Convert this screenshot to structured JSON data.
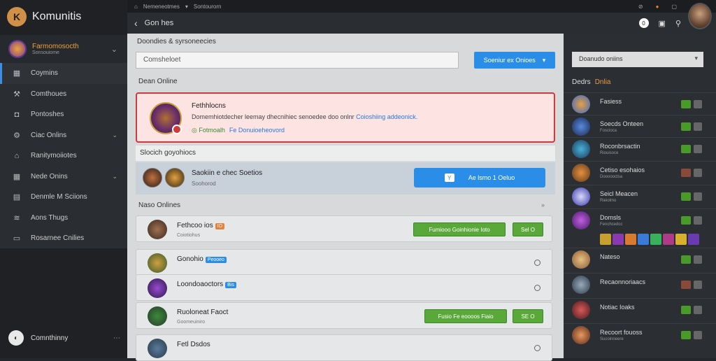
{
  "app": {
    "title": "Komunitis"
  },
  "topbar": {
    "tab1": "Nemeneotmes",
    "tab2": "Sontourorn"
  },
  "subbar": {
    "title": "Gon hes",
    "badge": "0"
  },
  "sidebar": {
    "server_name": "Farmomosocth",
    "server_sub": "Sonsouiome",
    "items": [
      {
        "label": "Coymins",
        "icon": "grid-icon",
        "active": true,
        "chevron": false
      },
      {
        "label": "Comthoues",
        "icon": "wrench-icon",
        "active": false,
        "chevron": false
      },
      {
        "label": "Pontoshes",
        "icon": "camera-icon",
        "active": false,
        "chevron": false
      },
      {
        "label": "Ciac Onlins",
        "icon": "gear-icon",
        "active": false,
        "chevron": true
      },
      {
        "label": "Ranitymoiiotes",
        "icon": "home-icon",
        "active": false,
        "chevron": false
      },
      {
        "label": "Nede Onins",
        "icon": "grid-icon",
        "active": false,
        "chevron": true
      },
      {
        "label": "Denmle M Sciions",
        "icon": "inbox-icon",
        "active": false,
        "chevron": false
      },
      {
        "label": "Aons Thugs",
        "icon": "layers-icon",
        "active": false,
        "chevron": false
      },
      {
        "label": "Rosarnee Cnilies",
        "icon": "monitor-icon",
        "active": false,
        "chevron": false
      }
    ],
    "community": "Comnthinny"
  },
  "main": {
    "search_title": "Doondies & syrsoneecies",
    "search_value": "Comsheloet",
    "search_button": "Soeniur ex Onioes",
    "section1": "Dean Online",
    "alert": {
      "title": "Fethhlocns",
      "desc": "Domemhiotdecher leemay dhecnihiec senoedee doo onlnr",
      "desc_link": "Coioshiing addeonick.",
      "status": "Fotmoalh",
      "status_link": "Fe Donuioeheovord"
    },
    "group_bar": "Slocich goyohiocs",
    "group": {
      "title": "Saokiin e chec Soetios",
      "sub": "Soohorod",
      "button": "Ae lsmo 1 Oeluo"
    },
    "section2": "Naso Onlines",
    "rows": [
      {
        "name": "Fethcoo ios",
        "tag": "IO",
        "tag_color": "#e8803a",
        "sub": "Coiotiohus",
        "btn": "Fumiooo Goinhionie Ioto",
        "btn2": "Sel O"
      },
      {
        "name": "Gonohio",
        "tag": "Peooeo",
        "tag_color": "#2a8ee8",
        "sub": "",
        "btn": "",
        "btn2": ""
      },
      {
        "name": "Loondoaoctors",
        "tag": "Bis",
        "tag_color": "#2a8ee8",
        "sub": "",
        "btn": "",
        "btn2": ""
      },
      {
        "name": "Ruoloneat Faoct",
        "tag": "",
        "tag_color": "",
        "sub": "Goomeuiniro",
        "btn": "Fusio Fe eoooos Fiaio",
        "btn2": "SE O"
      },
      {
        "name": "Fetl Dsdos",
        "tag": "",
        "tag_color": "",
        "sub": "",
        "btn": "",
        "btn2": ""
      }
    ]
  },
  "right": {
    "select": "Doanudo oniins",
    "head": "Dedrs",
    "head_accent": "Dnlia",
    "items": [
      {
        "name": "Fasiess",
        "sub": "",
        "status": "on"
      },
      {
        "name": "Soecds Onteen",
        "sub": "Foscioca",
        "status": "on"
      },
      {
        "name": "Roconbrsactin",
        "sub": "Riouisoce",
        "status": "on"
      },
      {
        "name": "Cetiso esohaios",
        "sub": "Doooooctsa",
        "status": "off"
      },
      {
        "name": "Seicl Meacen",
        "sub": "Rieiolmo",
        "status": "on"
      },
      {
        "name": "Domsls",
        "sub": "Fenchcedcc",
        "status": "on"
      },
      {
        "name": "Nateso",
        "sub": "",
        "status": "on"
      },
      {
        "name": "Recaonnoriaacs",
        "sub": "",
        "status": "off"
      },
      {
        "name": "Notiac Ioaks",
        "sub": "",
        "status": "on"
      },
      {
        "name": "Recoort fouoss",
        "sub": "Sucoinneere",
        "status": "on"
      }
    ]
  }
}
